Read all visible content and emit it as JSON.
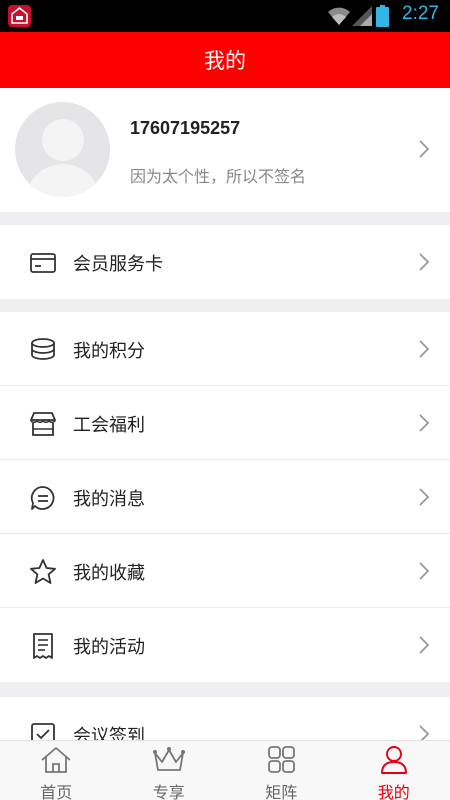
{
  "status_bar": {
    "time": "2:27"
  },
  "header": {
    "title": "我的"
  },
  "profile": {
    "phone": "17607195257",
    "signature": "因为太个性，所以不签名"
  },
  "menu": {
    "member_card": "会员服务卡",
    "points": "我的积分",
    "union_welfare": "工会福利",
    "messages": "我的消息",
    "favorites": "我的收藏",
    "activities": "我的活动",
    "meeting_checkin": "会议签到"
  },
  "tab_bar": {
    "tabs": [
      {
        "label": "首页",
        "icon": "home-icon"
      },
      {
        "label": "专享",
        "icon": "crown-icon"
      },
      {
        "label": "矩阵",
        "icon": "grid-icon"
      },
      {
        "label": "我的",
        "icon": "user-icon"
      }
    ],
    "active_tab": "我的"
  },
  "colors": {
    "brand": "#ff0000",
    "active_tab": "#e60012"
  }
}
